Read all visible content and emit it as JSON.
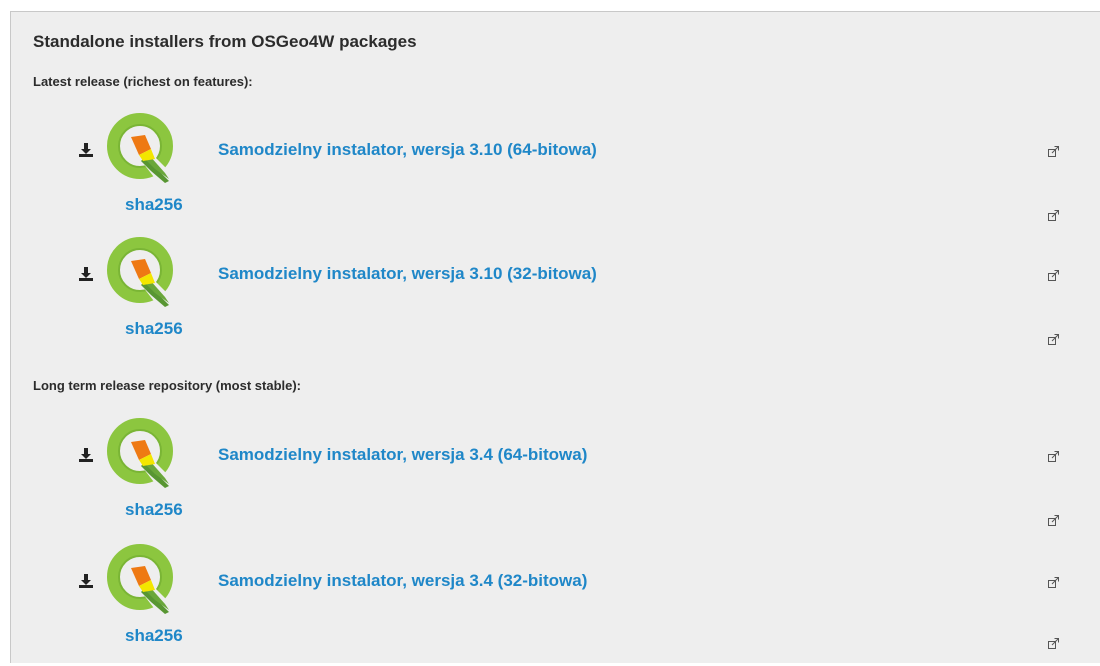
{
  "page": {
    "title": "Standalone installers from OSGeo4W packages"
  },
  "sections": [
    {
      "label": "Latest release (richest on features):",
      "installers": [
        {
          "link_text": "Samodzielny instalator, wersja 3.10 (64-bitowa)",
          "sha_text": "sha256",
          "download_icon": "download-icon",
          "logo": "qgis-logo",
          "external_icon": "external-link-icon"
        },
        {
          "link_text": "Samodzielny instalator, wersja 3.10 (32-bitowa)",
          "sha_text": "sha256",
          "download_icon": "download-icon",
          "logo": "qgis-logo",
          "external_icon": "external-link-icon"
        }
      ]
    },
    {
      "label": "Long term release repository (most stable):",
      "installers": [
        {
          "link_text": "Samodzielny instalator, wersja 3.4 (64-bitowa)",
          "sha_text": "sha256",
          "download_icon": "download-icon",
          "logo": "qgis-logo",
          "external_icon": "external-link-icon"
        },
        {
          "link_text": "Samodzielny instalator, wersja 3.4 (32-bitowa)",
          "sha_text": "sha256",
          "download_icon": "download-icon",
          "logo": "qgis-logo",
          "external_icon": "external-link-icon"
        }
      ]
    }
  ],
  "colors": {
    "panel_background": "#eeeeee",
    "link": "#1f87c8",
    "text": "#2c2c2c",
    "logo_green": "#8cc63f",
    "logo_dark_green": "#589632",
    "logo_orange": "#ee7913",
    "logo_yellow": "#f3e600"
  }
}
